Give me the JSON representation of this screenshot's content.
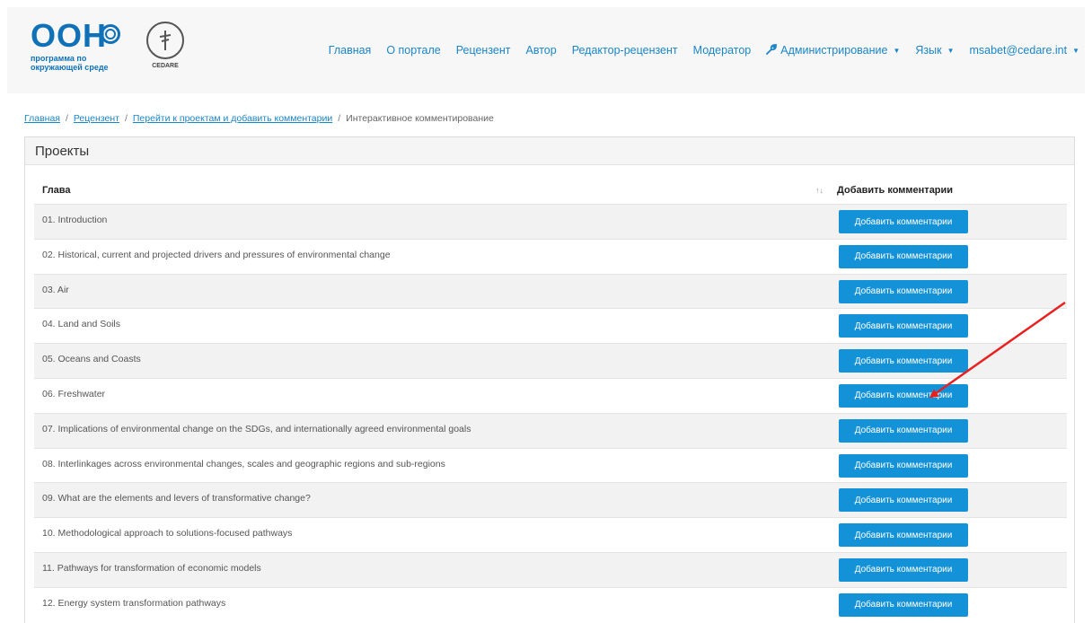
{
  "logo": {
    "unep_big": "ООН",
    "unep_sub": "программа по окружающей среде",
    "cedare_label": "CEDARE"
  },
  "nav": {
    "items": [
      {
        "label": "Главная"
      },
      {
        "label": "О портале"
      },
      {
        "label": "Рецензент"
      },
      {
        "label": "Автор"
      },
      {
        "label": "Редактор-рецензент"
      },
      {
        "label": "Модератор"
      },
      {
        "label": "Администрирование"
      },
      {
        "label": "Язык"
      },
      {
        "label": "msabet@cedare.int"
      }
    ]
  },
  "breadcrumb": [
    "Главная",
    "Рецензент",
    "Перейти к проектам и добавить комментарии",
    "Интерактивное комментирование"
  ],
  "card": {
    "title": "Проекты"
  },
  "table": {
    "col_chapter": "Глава",
    "sort_icon": "↑↓",
    "col_action": "Добавить комментарии",
    "button_label": "Добавить комментарии",
    "rows": [
      "01. Introduction",
      "02. Historical, current and projected drivers and pressures of environmental change",
      "03. Air",
      "04. Land and Soils",
      "05. Oceans and Coasts",
      "06. Freshwater",
      "07. Implications of environmental change on the SDGs, and internationally agreed environmental goals",
      "08. Interlinkages across environmental changes, scales and geographic regions and sub-regions",
      "09. What are the elements and levers of transformative change?",
      "10. Methodological approach to solutions-focused pathways",
      "11. Pathways for transformation of economic models",
      "12. Energy system transformation pathways"
    ]
  },
  "colors": {
    "brand_blue": "#0f72b8",
    "link_blue": "#1a86c8",
    "button_blue": "#1492d8",
    "annotation_red": "#e8211f"
  }
}
